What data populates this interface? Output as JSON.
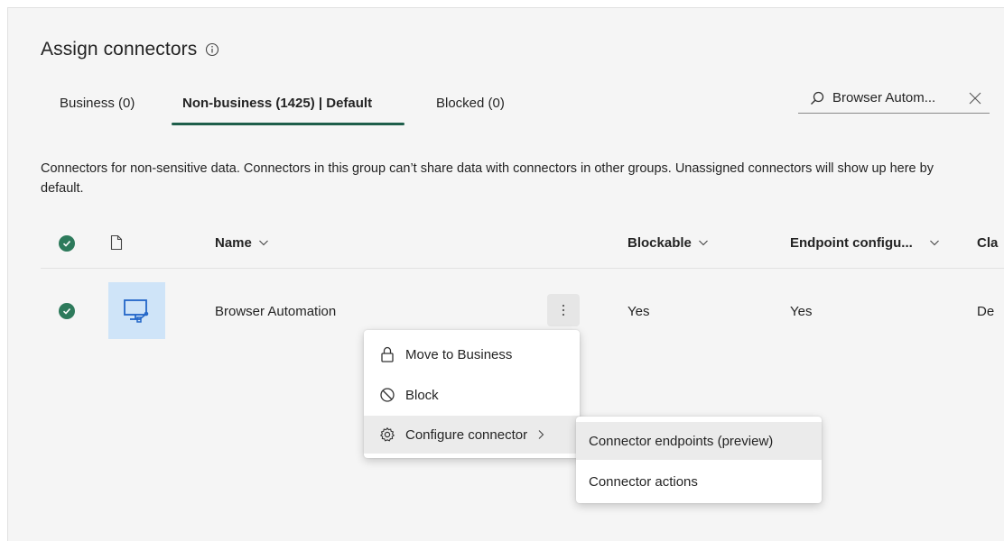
{
  "title": "Assign connectors",
  "tabs": [
    {
      "label": "Business (0)"
    },
    {
      "label": "Non-business (1425) | Default"
    },
    {
      "label": "Blocked (0)"
    }
  ],
  "search": {
    "value": "Browser Autom..."
  },
  "description": "Connectors for non-sensitive data. Connectors in this group can’t share data with connectors in other groups. Unassigned connectors will show up here by default.",
  "table": {
    "columns": {
      "name": "Name",
      "blockable": "Blockable",
      "endpoint": "Endpoint configu...",
      "class": "Cla"
    },
    "rows": [
      {
        "name": "Browser Automation",
        "blockable": "Yes",
        "endpoint": "Yes",
        "class": "De"
      }
    ]
  },
  "context_menu": {
    "items": [
      {
        "label": "Move to Business",
        "icon": "lock-icon"
      },
      {
        "label": "Block",
        "icon": "block-icon"
      },
      {
        "label": "Configure connector",
        "icon": "gear-icon"
      }
    ]
  },
  "submenu": {
    "items": [
      {
        "label": "Connector endpoints (preview)"
      },
      {
        "label": "Connector actions"
      }
    ]
  },
  "colors": {
    "accent": "#1e5e4a",
    "check": "#2d7a5b",
    "tile": "#cfe4f8",
    "tile_icon": "#2266c8"
  }
}
